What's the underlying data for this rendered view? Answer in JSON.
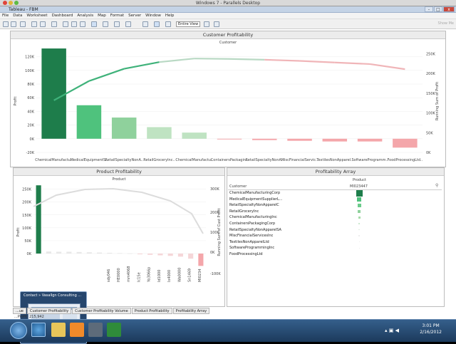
{
  "window": {
    "parallels_title": "Windows 7 - Parallels Desktop",
    "app_title": "Tableau - FBM",
    "controls": {
      "min": "-",
      "max": "□",
      "close": "x"
    }
  },
  "menubar": [
    "File",
    "Data",
    "Worksheet",
    "Dashboard",
    "Analysis",
    "Map",
    "Format",
    "Server",
    "Window",
    "Help"
  ],
  "toolbar": {
    "view_select": "Entire View",
    "show_me": "Show Me"
  },
  "customer_profitability": {
    "title": "Customer Profitability",
    "subtitle": "Customer",
    "y_label": "Profit",
    "y2_label": "Running Sum of Profit",
    "y_ticks": [
      "120K",
      "100K",
      "80K",
      "60K",
      "40K",
      "20K",
      "0K",
      "-20K"
    ],
    "y2_ticks": [
      "250K",
      "200K",
      "150K",
      "100K",
      "50K",
      "0K"
    ]
  },
  "product_profitability": {
    "title": "Product Profitability",
    "subtitle": "Product",
    "y_label": "Profit",
    "y2_label": "Running Sum of Cust Profit",
    "y_ticks": [
      "250K",
      "200K",
      "150K",
      "100K",
      "50K",
      "0K"
    ],
    "y2_ticks": [
      "300K",
      "200K",
      "100K",
      "0K",
      "-100K"
    ]
  },
  "profitability_array": {
    "title": "Profitability Array",
    "col_header": "Product",
    "col_value": "MI023447",
    "row_header": "Customer",
    "rows": [
      "ChemicalManufacturingCorp",
      "MedicalEquipmentSupplierL...",
      "RetailSpecialtyNonApparelC",
      "RetailGroceryInc",
      "ChemicalManufacturingInc",
      "ContainersPackagingCorp",
      "RetailSpecialtyNonApparelSA",
      "MiscFinancialServicesInc",
      "TextilesNonApparelLtd",
      "SoftwareProgrammingInc",
      "FoodProcessingLtd"
    ]
  },
  "tabs": [
    "...ue",
    "Customer Profitability",
    "Customer Profitability Volume",
    "Product Profitability",
    "Profitability Array"
  ],
  "status": "...Profit: 215,942",
  "thumbnail": {
    "title": "Contact » Vasallgn Consulting ..."
  },
  "clock": {
    "time": "3:01 PM",
    "date": "2/16/2012"
  },
  "colors": {
    "green_dark": "#1e7d4b",
    "green_mid": "#4fc27d",
    "green_light": "#a6dba8",
    "pink": "#f4a6aa",
    "line_green": "#3fb27a"
  },
  "chart_data": [
    {
      "type": "bar",
      "title": "Customer Profitability",
      "xlabel": "Customer",
      "ylabel": "Profit",
      "categories": [
        "ChemicalManufactu..",
        "MedicalEquipmentS..",
        "RetailSpecialtyNonA..",
        "RetailGroceryInc..",
        "ChemicalManufactu..",
        "ContainersPackagin..",
        "RetailSpecialtyNonA..",
        "MiscFinancialServic..",
        "TextilesNonApparel..",
        "SoftwareProgramm..",
        "FoodProcessingLtd.."
      ],
      "values": [
        132,
        49,
        31,
        17,
        9,
        -1,
        -2,
        -3,
        -4,
        -4,
        -13
      ],
      "ylim": [
        -20,
        130
      ],
      "running_sum": [
        132,
        181,
        212,
        229,
        238,
        237,
        235,
        232,
        228,
        224,
        211
      ],
      "y2lim": [
        0,
        260
      ]
    },
    {
      "type": "bar",
      "title": "Product Profitability",
      "xlabel": "Product",
      "ylabel": "Profit",
      "categories": [
        "",
        "",
        "",
        "",
        "",
        "",
        "",
        "sdy046",
        "HE0000",
        "mm4068",
        "Ic1Se",
        "Yo3066p",
        "Id1000",
        "Ix4000",
        "Wa0000",
        "Sn1469",
        "MI0234"
      ],
      "values": [
        265,
        8,
        7,
        7,
        6,
        5,
        4,
        3,
        2,
        1,
        -3,
        -5,
        -7,
        -9,
        -12,
        -20,
        -48
      ],
      "ylim": [
        -10,
        260
      ]
    }
  ]
}
